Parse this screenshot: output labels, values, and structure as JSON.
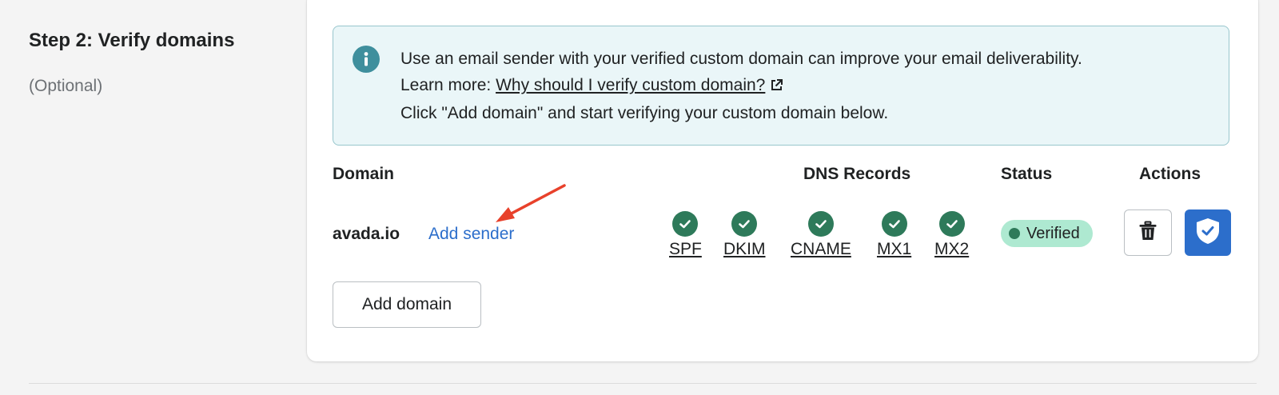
{
  "section": {
    "title": "Step 2: Verify domains",
    "subtitle": "(Optional)"
  },
  "banner": {
    "line1": "Use an email sender with your verified custom domain can improve your email deliverability.",
    "line2_prefix": "Learn more: ",
    "line2_link": "Why should I verify custom domain?",
    "line3": "Click \"Add domain\" and start verifying your custom domain below.",
    "icon": "info-icon",
    "background": "#eaf6f8",
    "border": "#98c6cd"
  },
  "table": {
    "headers": {
      "domain": "Domain",
      "dns_records": "DNS Records",
      "status": "Status",
      "actions": "Actions"
    },
    "rows": [
      {
        "domain": "avada.io",
        "add_sender_label": "Add sender",
        "dns": [
          "SPF",
          "DKIM",
          "CNAME",
          "MX1",
          "MX2"
        ],
        "status": "Verified",
        "status_color": "#aee9d1"
      }
    ]
  },
  "buttons": {
    "add_domain": "Add domain",
    "delete_icon": "trash-icon",
    "verify_icon": "shield-check-icon"
  },
  "colors": {
    "accent": "#2c6ecb",
    "check": "#2e7a5a",
    "annotation_arrow": "#e8412b"
  }
}
